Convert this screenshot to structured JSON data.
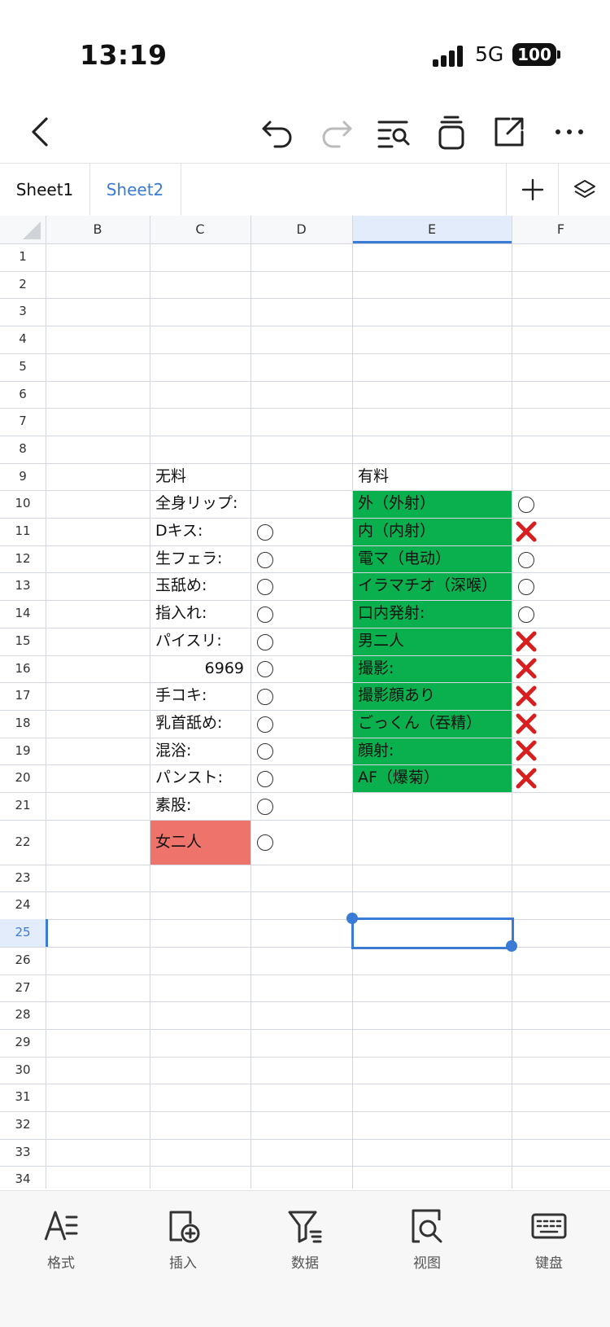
{
  "status_bar": {
    "time": "13:19",
    "network": "5G",
    "battery": "100"
  },
  "toolbar": {
    "icons": [
      "back-icon",
      "undo-icon",
      "redo-icon",
      "find-icon",
      "clear-format-icon",
      "share-icon",
      "more-icon"
    ]
  },
  "tabs": [
    {
      "label": "Sheet1",
      "active": false
    },
    {
      "label": "Sheet2",
      "active": true
    }
  ],
  "sheet": {
    "columns": [
      "B",
      "C",
      "D",
      "E",
      "F"
    ],
    "selected_column": "E",
    "selected_row": "25",
    "rows": [
      "1",
      "2",
      "3",
      "4",
      "5",
      "6",
      "7",
      "8",
      "9",
      "10",
      "11",
      "12",
      "13",
      "14",
      "15",
      "16",
      "17",
      "18",
      "19",
      "20",
      "21",
      "22",
      "23",
      "24",
      "25",
      "26",
      "27",
      "28",
      "29",
      "30",
      "31",
      "32",
      "33",
      "34"
    ],
    "headers": {
      "free": "无料",
      "paid": "有料"
    },
    "free_items": [
      {
        "row": 10,
        "label": "全身リップ:",
        "mark": ""
      },
      {
        "row": 11,
        "label": "Dキス:",
        "mark": "circle"
      },
      {
        "row": 12,
        "label": "生フェラ:",
        "mark": "circle"
      },
      {
        "row": 13,
        "label": "玉舐め:",
        "mark": "circle"
      },
      {
        "row": 14,
        "label": "指入れ:",
        "mark": "circle"
      },
      {
        "row": 15,
        "label": "パイスリ:",
        "mark": "circle"
      },
      {
        "row": 16,
        "label": "6969",
        "mark": "circle",
        "align": "right"
      },
      {
        "row": 17,
        "label": "手コキ:",
        "mark": "circle"
      },
      {
        "row": 18,
        "label": "乳首舐め:",
        "mark": "circle"
      },
      {
        "row": 19,
        "label": "混浴:",
        "mark": "circle"
      },
      {
        "row": 20,
        "label": "パンスト:",
        "mark": "circle"
      },
      {
        "row": 21,
        "label": "素股:",
        "mark": "circle"
      },
      {
        "row": 22,
        "label": "女二人",
        "mark": "circle",
        "fill": "#ee746b"
      }
    ],
    "paid_items": [
      {
        "row": 10,
        "label": "外（外射）",
        "mark": "circle"
      },
      {
        "row": 11,
        "label": "内（内射）",
        "mark": "cross"
      },
      {
        "row": 12,
        "label": "電マ（电动）",
        "mark": "circle"
      },
      {
        "row": 13,
        "label": "イラマチオ（深喉）",
        "mark": "circle"
      },
      {
        "row": 14,
        "label": "口内発射:",
        "mark": "circle"
      },
      {
        "row": 15,
        "label": "男二人",
        "mark": "cross"
      },
      {
        "row": 16,
        "label": "撮影:",
        "mark": "cross"
      },
      {
        "row": 17,
        "label": "撮影顔あり",
        "mark": "cross"
      },
      {
        "row": 18,
        "label": "ごっくん（吞精）",
        "mark": "cross"
      },
      {
        "row": 19,
        "label": "顔射:",
        "mark": "cross"
      },
      {
        "row": 20,
        "label": "AF（爆菊）",
        "mark": "cross"
      }
    ],
    "paid_fill": "#0aaf4e",
    "cross_color": "#d81e1e",
    "selection_color": "#3a7bd5"
  },
  "bottom_bar": [
    {
      "label": "格式",
      "icon": "format-icon"
    },
    {
      "label": "插入",
      "icon": "insert-icon"
    },
    {
      "label": "数据",
      "icon": "filter-icon"
    },
    {
      "label": "视图",
      "icon": "view-icon"
    },
    {
      "label": "键盘",
      "icon": "keyboard-icon"
    }
  ]
}
